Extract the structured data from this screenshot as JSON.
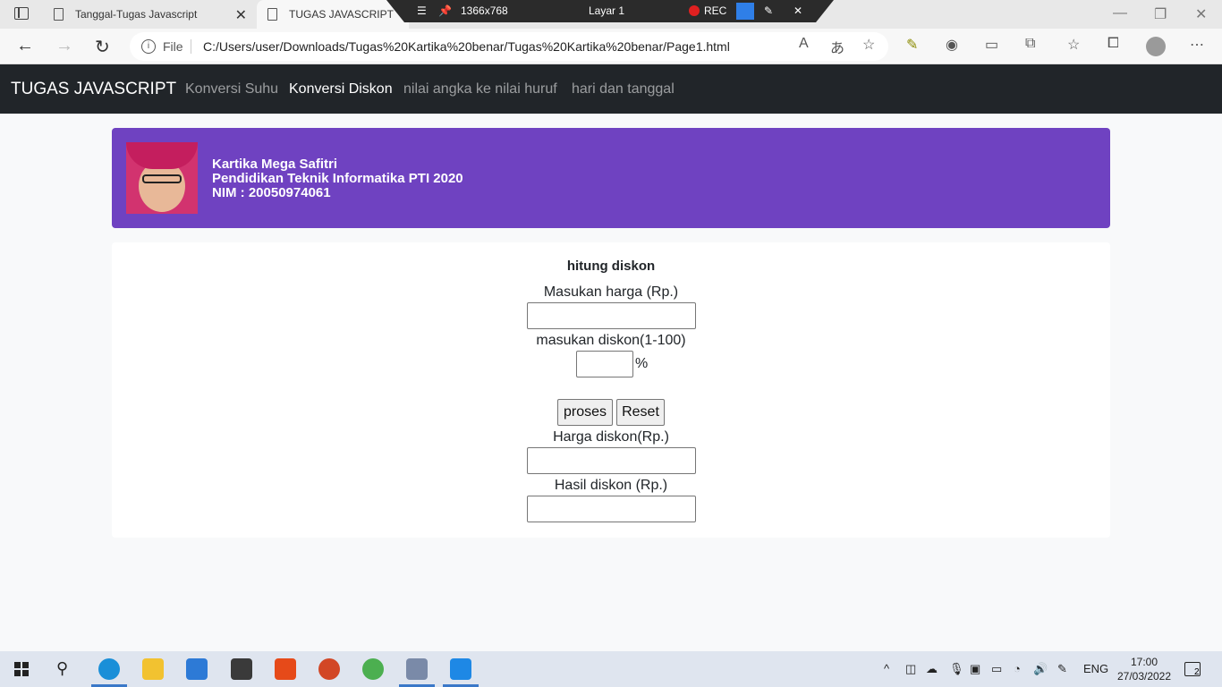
{
  "browser": {
    "tabs": [
      {
        "title": "Tanggal-Tugas Javascript"
      },
      {
        "title": "TUGAS JAVASCRIPT"
      }
    ],
    "recorder": {
      "resolution": "1366x768",
      "layer": "Layar 1",
      "rec": "REC"
    },
    "address": {
      "file_label": "File",
      "url": "C:/Users/user/Downloads/Tugas%20Kartika%20benar/Tugas%20Kartika%20benar/Page1.html"
    }
  },
  "navbar": {
    "brand": "TUGAS JAVASCRIPT",
    "links": [
      "Konversi Suhu",
      "Konversi Diskon",
      "nilai angka ke nilai huruf",
      "hari dan tanggal"
    ],
    "active": "Konversi Diskon"
  },
  "profile": {
    "name": "Kartika Mega Safitri",
    "program": "Pendidikan Teknik Informatika PTI 2020",
    "nim": "NIM : 20050974061"
  },
  "form": {
    "title": "hitung diskon",
    "price_label": "Masukan harga (Rp.)",
    "price_value": "",
    "discount_label": "masukan diskon(1-100)",
    "discount_value": "",
    "percent_sign": "%",
    "process_button": "proses",
    "reset_button": "Reset",
    "discount_amount_label": "Harga diskon(Rp.)",
    "discount_amount_value": "",
    "result_label": "Hasil diskon (Rp.)",
    "result_value": ""
  },
  "taskbar": {
    "language": "ENG",
    "time": "17:00",
    "date": "27/03/2022",
    "notification_count": "2"
  }
}
